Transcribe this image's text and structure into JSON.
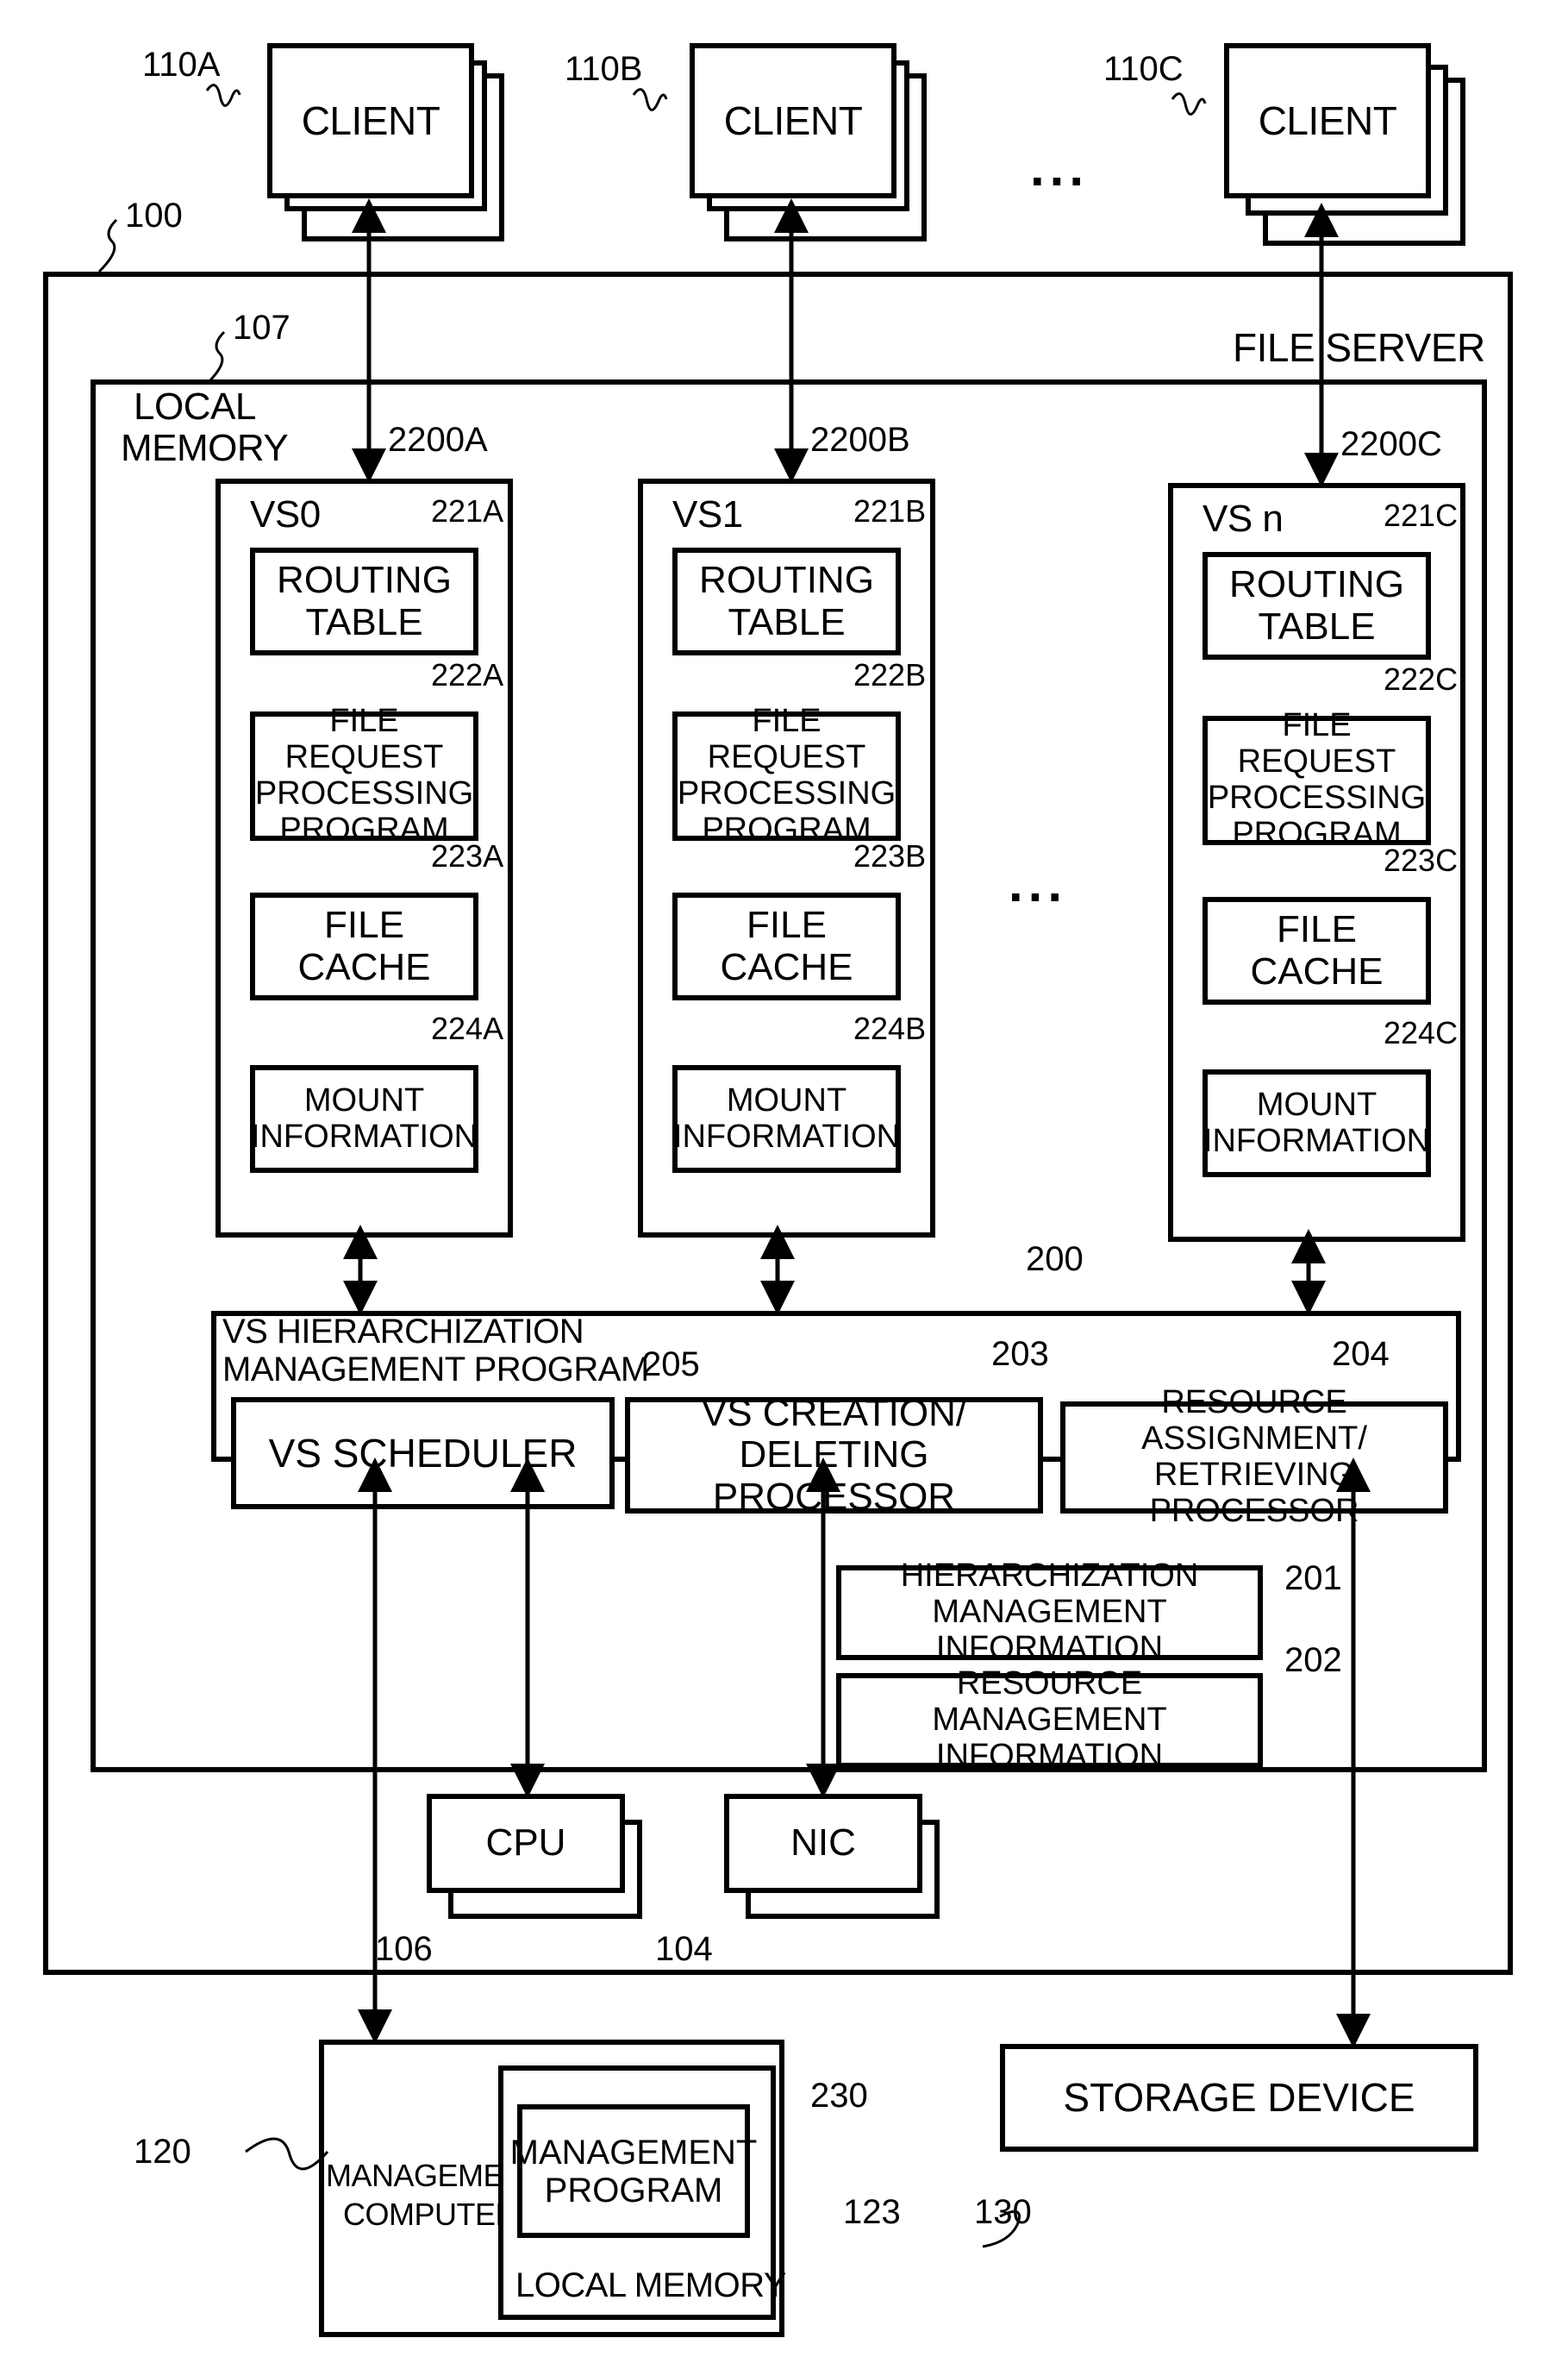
{
  "clients": [
    {
      "ref": "110A",
      "label": "CLIENT"
    },
    {
      "ref": "110B",
      "label": "CLIENT"
    },
    {
      "ref": "110C",
      "label": "CLIENT"
    }
  ],
  "ellipsis": "...",
  "file_server": {
    "ref": "100",
    "label": "FILE SERVER"
  },
  "local_memory": {
    "ref": "107",
    "label_line1": "LOCAL",
    "label_line2": "MEMORY"
  },
  "virtual_servers": [
    {
      "ref": "2200A",
      "name": "VS0",
      "routing": {
        "ref": "221A",
        "l1": "ROUTING",
        "l2": "TABLE"
      },
      "frp": {
        "ref": "222A",
        "l1": "FILE REQUEST",
        "l2": "PROCESSING",
        "l3": "PROGRAM"
      },
      "cache": {
        "ref": "223A",
        "l1": "FILE",
        "l2": "CACHE"
      },
      "mount": {
        "ref": "224A",
        "l1": "MOUNT",
        "l2": "INFORMATION"
      }
    },
    {
      "ref": "2200B",
      "name": "VS1",
      "routing": {
        "ref": "221B",
        "l1": "ROUTING",
        "l2": "TABLE"
      },
      "frp": {
        "ref": "222B",
        "l1": "FILE REQUEST",
        "l2": "PROCESSING",
        "l3": "PROGRAM"
      },
      "cache": {
        "ref": "223B",
        "l1": "FILE",
        "l2": "CACHE"
      },
      "mount": {
        "ref": "224B",
        "l1": "MOUNT",
        "l2": "INFORMATION"
      }
    },
    {
      "ref": "2200C",
      "name": "VS n",
      "routing": {
        "ref": "221C",
        "l1": "ROUTING",
        "l2": "TABLE"
      },
      "frp": {
        "ref": "222C",
        "l1": "FILE REQUEST",
        "l2": "PROCESSING",
        "l3": "PROGRAM"
      },
      "cache": {
        "ref": "223C",
        "l1": "FILE",
        "l2": "CACHE"
      },
      "mount": {
        "ref": "224C",
        "l1": "MOUNT",
        "l2": "INFORMATION"
      }
    }
  ],
  "vs_program": {
    "ref": "200",
    "label_line1": "VS HIERARCHIZATION",
    "label_line2": "MANAGEMENT PROGRAM",
    "scheduler": {
      "ref": "205",
      "label": "VS SCHEDULER"
    },
    "creation": {
      "ref": "203",
      "l1": "VS CREATION/",
      "l2": "DELETING PROCESSOR"
    },
    "resource": {
      "ref": "204",
      "l1": "RESOURCE ASSIGNMENT/",
      "l2": "RETRIEVING PROCESSOR"
    }
  },
  "hier_info": {
    "ref": "201",
    "l1": "HIERARCHIZATION",
    "l2": "MANAGEMENT INFORMATION"
  },
  "res_info": {
    "ref": "202",
    "l1": "RESOURCE MANAGEMENT",
    "l2": "INFORMATION"
  },
  "cpu": {
    "ref": "106",
    "label": "CPU"
  },
  "nic": {
    "ref": "104",
    "label": "NIC"
  },
  "mgmt_computer": {
    "ref": "120",
    "l1": "MANAGEMENT",
    "l2": "COMPUTER"
  },
  "mgmt_program": {
    "ref": "230",
    "l1": "MANAGEMENT",
    "l2": "PROGRAM"
  },
  "mgmt_local_memory": {
    "ref": "123",
    "label": "LOCAL MEMORY"
  },
  "storage": {
    "ref": "130",
    "label": "STORAGE DEVICE"
  }
}
